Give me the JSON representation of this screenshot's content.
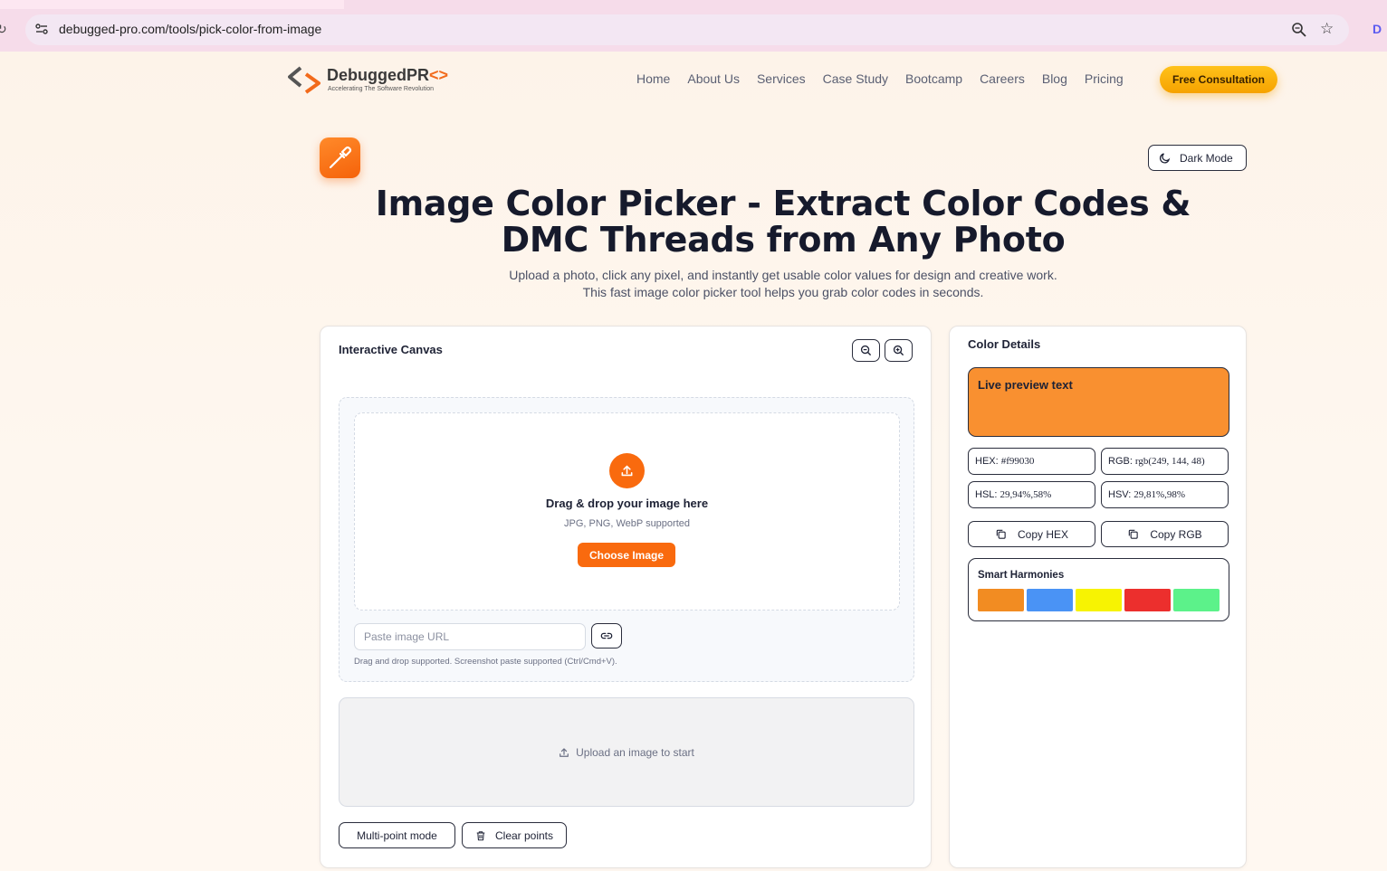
{
  "browser": {
    "url": "debugged-pro.com/tools/pick-color-from-image"
  },
  "header": {
    "logo_name": "DebuggedPR",
    "logo_arrows": "<>",
    "logo_tagline": "Accelerating The Software Revolution",
    "nav": [
      "Home",
      "About Us",
      "Services",
      "Case Study",
      "Bootcamp",
      "Careers",
      "Blog",
      "Pricing"
    ],
    "cta_label": "Free Consultation"
  },
  "hero": {
    "dark_mode_label": "Dark Mode",
    "title": "Image Color Picker - Extract Color Codes & DMC Threads from Any Photo",
    "subtitle": "Upload a photo, click any pixel, and instantly get usable color values for design and creative work. This fast image color picker tool helps you grab color codes in seconds."
  },
  "canvas": {
    "title": "Interactive Canvas",
    "drop_title": "Drag & drop your image here",
    "drop_formats": "JPG, PNG, WebP supported",
    "choose_label": "Choose Image",
    "url_placeholder": "Paste image URL",
    "helper_text": "Drag and drop supported. Screenshot paste supported (Ctrl/Cmd+V).",
    "placeholder_text": "Upload an image to start",
    "multi_point_label": "Multi-point mode",
    "clear_points_label": "Clear points"
  },
  "details": {
    "title": "Color Details",
    "preview_text": "Live preview text",
    "preview_color": "#f99030",
    "hex_label": "HEX:",
    "hex_value": "#f99030",
    "rgb_label": "RGB:",
    "rgb_value": "rgb(249, 144, 48)",
    "hsl_label": "HSL:",
    "hsl_value": "29,94%,58%",
    "hsv_label": "HSV:",
    "hsv_value": "29,81%,98%",
    "copy_hex_label": "Copy HEX",
    "copy_rgb_label": "Copy RGB",
    "harmonies_title": "Smart Harmonies",
    "harmony_colors": [
      "#f28c22",
      "#4a93f5",
      "#f7f302",
      "#ec2f2d",
      "#5cf28a"
    ]
  },
  "colors": {
    "accent_orange": "#f96a0e",
    "cta_yellow": "#ffc21a",
    "text_dark": "#161a2c"
  }
}
